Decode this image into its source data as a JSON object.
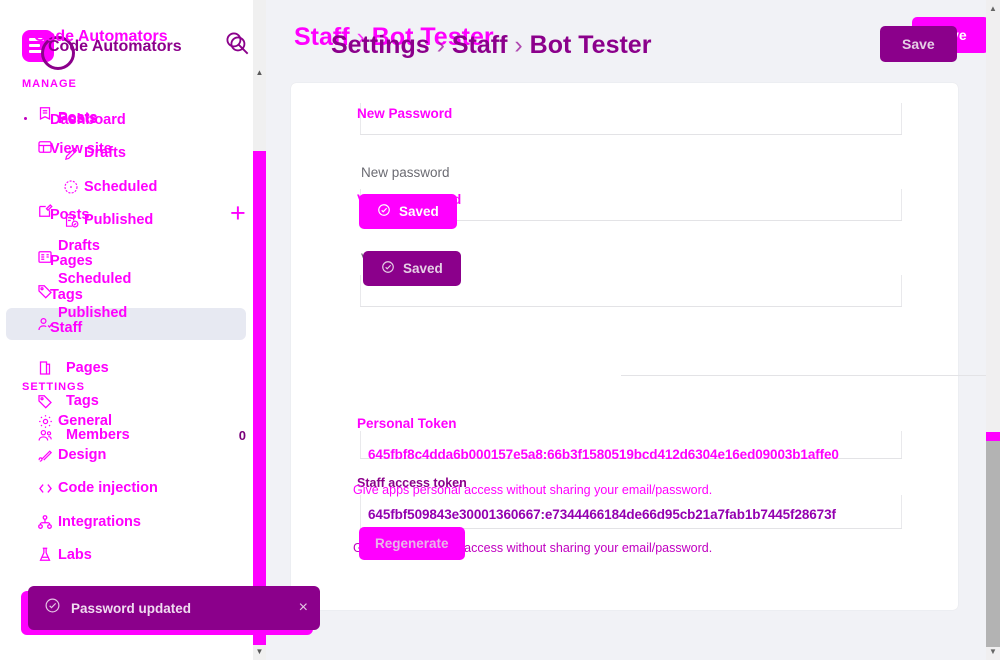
{
  "app": {
    "brand_name": "Code Automators",
    "brand_name_shadow": "Code Automators"
  },
  "sidebar": {
    "sections": {
      "manage": "MANAGE",
      "settings": "SETTINGS"
    },
    "primary_items": [
      {
        "label": "Dashboard",
        "icon": "dashboard-icon"
      },
      {
        "label": "View site",
        "icon": "external-site-icon"
      },
      {
        "label": "Posts",
        "icon": "posts-icon"
      },
      {
        "label": "Pages",
        "icon": "pages-icon"
      },
      {
        "label": "Tags",
        "icon": "tag-icon"
      },
      {
        "label": "Staff",
        "icon": "staff-icon"
      }
    ],
    "overlay_items": [
      {
        "label": "Posts",
        "icon": "posts-icon"
      },
      {
        "label": "Drafts",
        "icon": "pencil-icon"
      },
      {
        "label": "Scheduled",
        "icon": "clock-icon"
      },
      {
        "label": "Published",
        "icon": "published-icon"
      },
      {
        "label": "Drafts",
        "icon": "drafts-icon"
      },
      {
        "label": "Scheduled",
        "icon": "scheduled-icon"
      },
      {
        "label": "Published",
        "icon": "published-icon"
      }
    ],
    "settings_items": [
      {
        "label": "General",
        "icon": "gear-icon",
        "count": ""
      },
      {
        "label": "Members",
        "icon": "members-icon",
        "count": "0"
      },
      {
        "label": "Design",
        "icon": "brush-icon",
        "count": ""
      },
      {
        "label": "Code injection",
        "icon": "code-icon",
        "count": ""
      },
      {
        "label": "Integrations",
        "icon": "integrations-icon",
        "count": ""
      },
      {
        "label": "Labs",
        "icon": "labs-icon",
        "count": ""
      }
    ],
    "new_post_label": "+"
  },
  "header": {
    "breadcrumb_front": {
      "root": "Staff",
      "sep": "›",
      "current": "Bot Tester"
    },
    "breadcrumb_back": {
      "root": "Settings",
      "sep1": "›",
      "mid": "Staff",
      "sep2": "›",
      "current": "Bot Tester"
    },
    "save_label": "Save",
    "save_label_shadow": "Save"
  },
  "form": {
    "new_password_label": "New Password",
    "new_password_placeholder": "New password",
    "new_password_value": "",
    "verify_password_label": "Verify Password",
    "verify_password_placeholder": "Verify password",
    "verify_password_value": "",
    "saved_button_label": "Saved",
    "saved_button_label_shadow": "Saved",
    "personal_token_label": "Personal Token",
    "personal_token_value": "645fbf8c4dda6b000157e5a8:66b3f1580519bcd412d6304e16ed09003b1affe0",
    "personal_token_help": "Give apps personal access without sharing your email/password.",
    "staff_access_token_label": "Staff access token",
    "staff_access_token_value": "645fbf509843e30001360667:e7344466184de66d95cb21a7fab1b7445f28673f",
    "staff_access_token_help": "Give apps personal access without sharing your email/password.",
    "regenerate_label": "Regenerate"
  },
  "toast": {
    "message": "Password updated",
    "close_label": "×",
    "icon": "check-circle-icon"
  },
  "scrollbars": {
    "up_arrow": "▲",
    "down_arrow": "▼"
  },
  "colors": {
    "magenta": "#ff00ff",
    "purple": "#8b008b",
    "page_bg": "#f1f2f6",
    "card_bg": "#ffffff"
  }
}
